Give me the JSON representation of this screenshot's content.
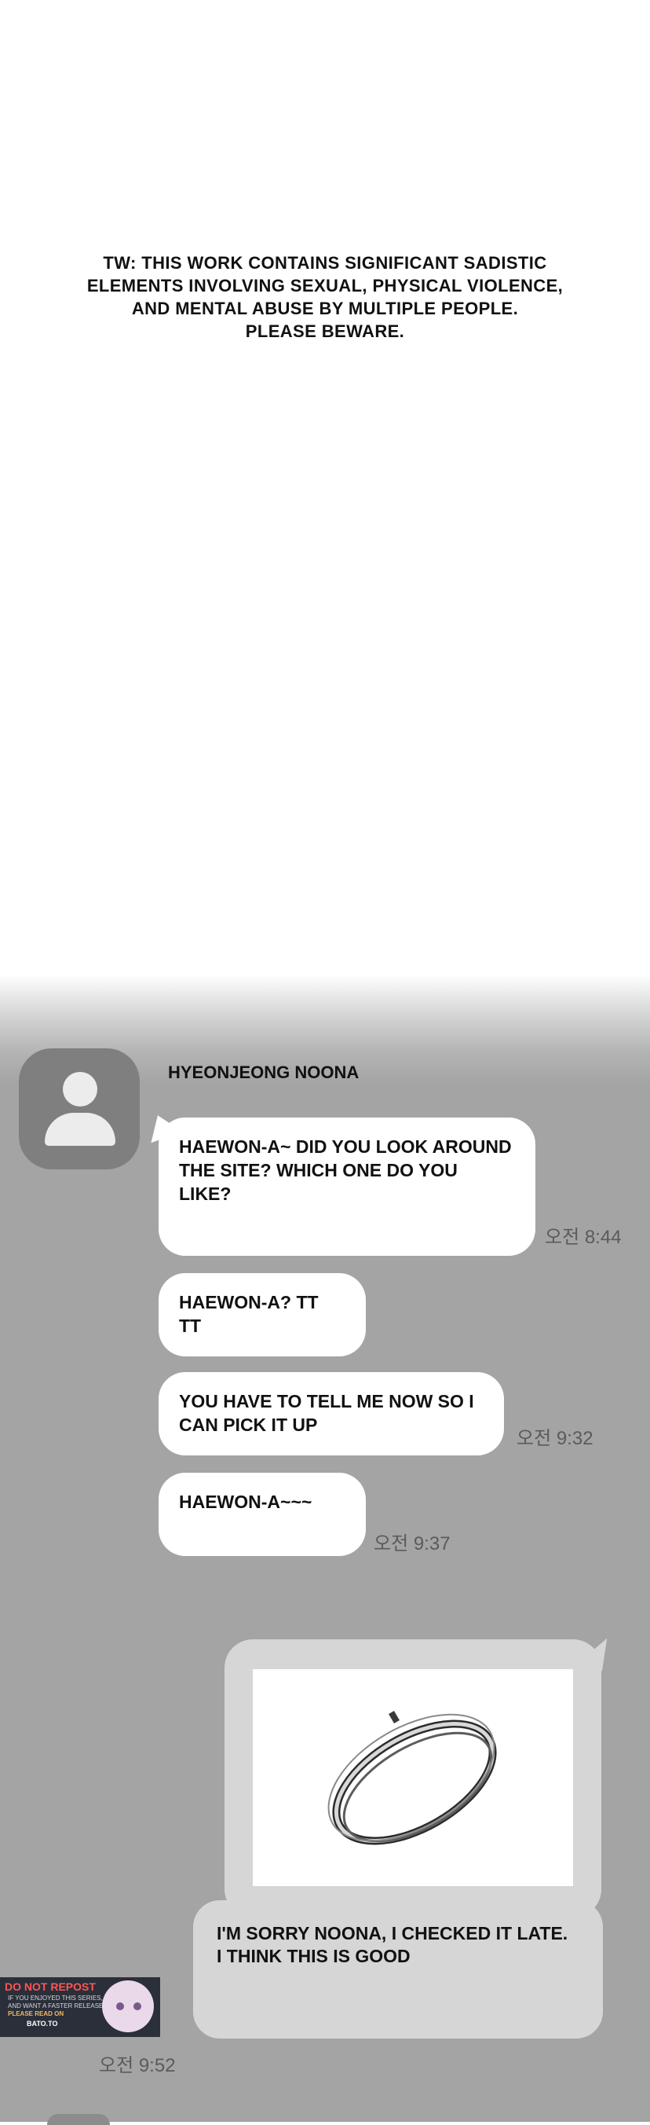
{
  "warning": {
    "lines": [
      "TW: THIS WORK CONTAINS SIGNIFICANT SADISTIC",
      "ELEMENTS INVOLVING SEXUAL, PHYSICAL VIOLENCE,",
      "AND MENTAL ABUSE BY MULTIPLE PEOPLE.",
      "PLEASE BEWARE."
    ]
  },
  "chat": {
    "sender": "HYEONJEONG NOONA",
    "messages": [
      {
        "lines": [
          "HAEWON-A~ DID YOU LOOK AROUND",
          "THE SITE? WHICH ONE DO YOU",
          "LIKE?"
        ],
        "time": "오전 8:44"
      },
      {
        "lines": [
          "HAEWON-A? TT TT"
        ]
      },
      {
        "lines": [
          "YOU HAVE TO TELL ME NOW SO I",
          "CAN PICK IT UP"
        ],
        "time": "오전 9:32"
      },
      {
        "lines": [
          "HAEWON-A~~~"
        ],
        "time": "오전 9:37"
      }
    ],
    "sent_image": {
      "subject": "silver-bangle-bracelet"
    },
    "reply": {
      "lines": [
        "I'M SORRY NOONA, I CHECKED IT LATE.",
        "I THINK THIS IS GOOD"
      ],
      "time": "오전 9:52"
    }
  },
  "banner": {
    "title": "DO NOT REPOST",
    "line1": "IF YOU ENJOYED THIS SERIES,",
    "line2": "AND WANT A FASTER RELEASE",
    "line3": "PLEASE READ ON",
    "site": "BATO.TO"
  },
  "colors": {
    "page_bg": "#ffffff",
    "chat_bg": "#a4a4a4",
    "incoming_bubble": "#ffffff",
    "outgoing_bubble": "#d6d6d6",
    "avatar": "#7f7f7f",
    "timestamp": "#5b5b5b"
  }
}
